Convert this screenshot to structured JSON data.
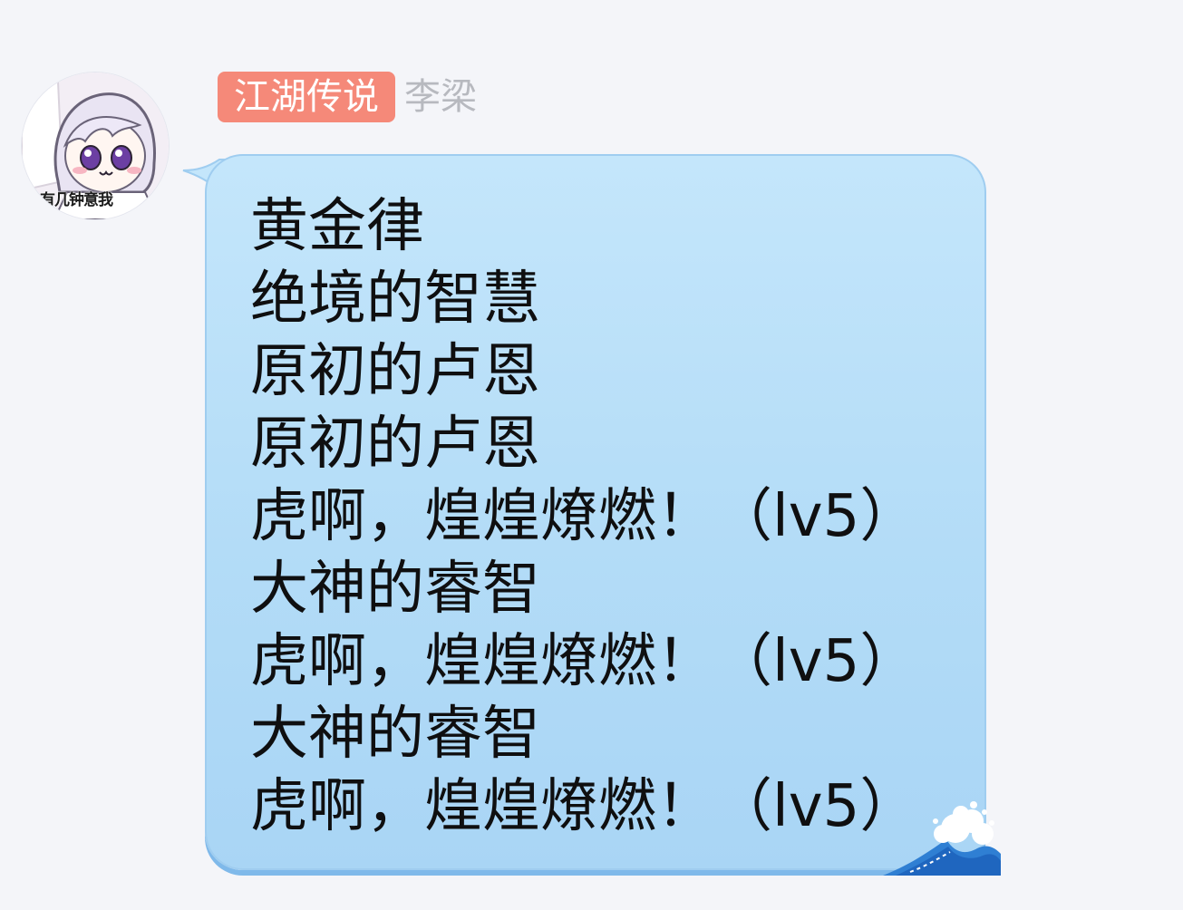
{
  "sender": {
    "title_badge": "江湖传说",
    "nickname": "李梁",
    "avatar_caption": "有几钟意我",
    "title_badge_color": "#f58979"
  },
  "message": {
    "lines": [
      "黄金律",
      "绝境的智慧",
      "原初的卢恩",
      "原初的卢恩",
      "虎啊，煌煌燎燃！（lv5）",
      "大神的睿智",
      "虎啊，煌煌燎燃！（lv5）",
      "大神的睿智",
      "虎啊，煌煌燎燃！（lv5）"
    ],
    "bubble_color": "#b8def8",
    "decoration_icon": "wave-icon"
  }
}
